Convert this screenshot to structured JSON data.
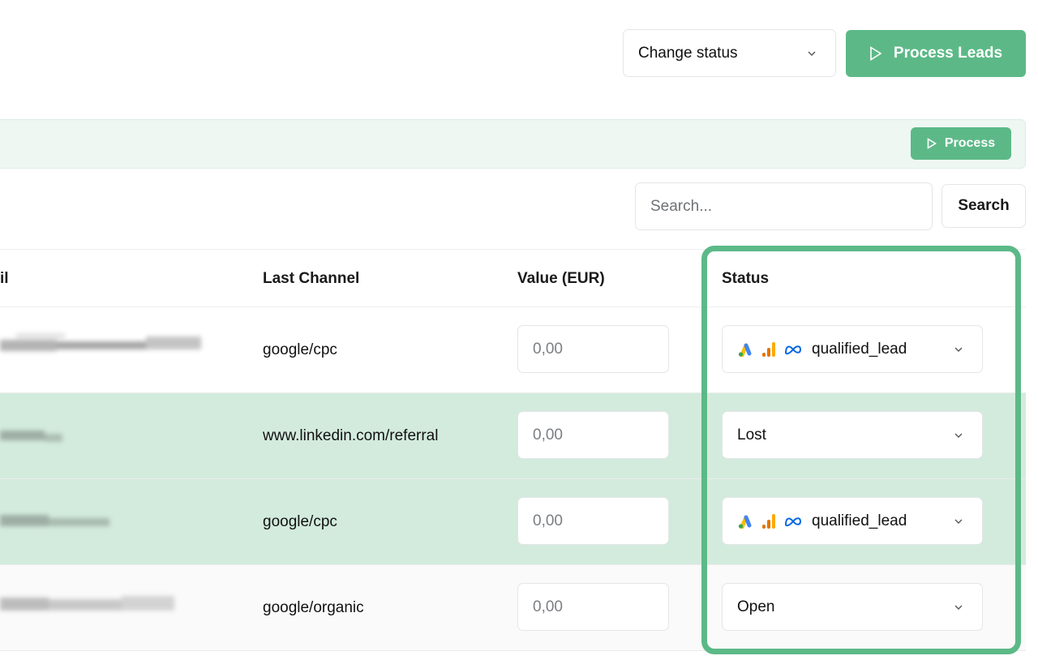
{
  "toolbar": {
    "change_status_label": "Change status",
    "process_leads_label": "Process Leads"
  },
  "banner": {
    "process_label": "Process"
  },
  "search": {
    "placeholder": "Search...",
    "button_label": "Search"
  },
  "table": {
    "headers": {
      "email_partial": "il",
      "last_channel": "Last Channel",
      "value": "Value (EUR)",
      "status": "Status"
    },
    "rows": [
      {
        "channel": "google/cpc",
        "value": "0,00",
        "status": "qualified_lead",
        "status_icons": [
          "google-ads-icon",
          "analytics-icon",
          "meta-icon"
        ],
        "highlight": false
      },
      {
        "channel": "www.linkedin.com/referral",
        "value": "0,00",
        "status": "Lost",
        "status_icons": [],
        "highlight": true
      },
      {
        "channel": "google/cpc",
        "value": "0,00",
        "status": "qualified_lead",
        "status_icons": [
          "google-ads-icon",
          "analytics-icon",
          "meta-icon"
        ],
        "highlight": true
      },
      {
        "channel": "google/organic",
        "value": "0,00",
        "status": "Open",
        "status_icons": [],
        "highlight": false
      }
    ]
  },
  "colors": {
    "accent": "#5cb987",
    "row_highlight": "#d3ebdd",
    "banner_bg": "#eef7f2"
  }
}
